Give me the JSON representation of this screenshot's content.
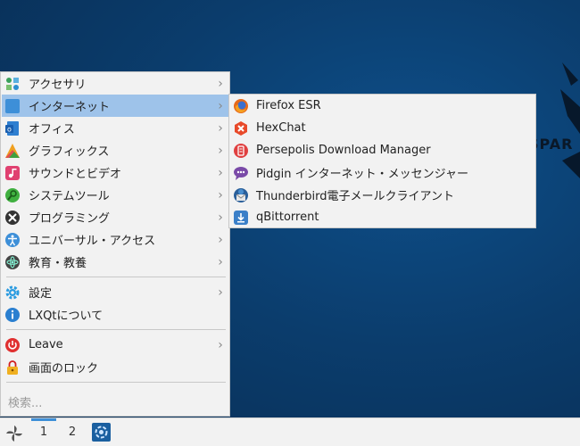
{
  "menu": {
    "items": [
      {
        "label": "アクセサリ",
        "icon": "accessories-icon",
        "has_submenu": true
      },
      {
        "label": "インターネット",
        "icon": "internet-icon",
        "has_submenu": true,
        "active": true
      },
      {
        "label": "オフィス",
        "icon": "office-icon",
        "has_submenu": true
      },
      {
        "label": "グラフィックス",
        "icon": "graphics-icon",
        "has_submenu": true
      },
      {
        "label": "サウンドとビデオ",
        "icon": "sound-video-icon",
        "has_submenu": true
      },
      {
        "label": "システムツール",
        "icon": "system-tools-icon",
        "has_submenu": true
      },
      {
        "label": "プログラミング",
        "icon": "programming-icon",
        "has_submenu": true
      },
      {
        "label": "ユニバーサル・アクセス",
        "icon": "accessibility-icon",
        "has_submenu": true
      },
      {
        "label": "教育・教養",
        "icon": "education-icon",
        "has_submenu": true
      }
    ],
    "settings_label": "設定",
    "about_label": "LXQtについて",
    "leave_label": "Leave",
    "lock_label": "画面のロック",
    "chevron": "›",
    "search_placeholder": "検索..."
  },
  "submenu": {
    "items": [
      {
        "label": "Firefox ESR",
        "icon": "firefox-icon"
      },
      {
        "label": "HexChat",
        "icon": "hexchat-icon"
      },
      {
        "label": "Persepolis Download Manager",
        "icon": "persepolis-icon"
      },
      {
        "label": "Pidgin インターネット・メッセンジャー",
        "icon": "pidgin-icon"
      },
      {
        "label": "Thunderbird電子メールクライアント",
        "icon": "thunderbird-icon"
      },
      {
        "label": "qBittorrent",
        "icon": "qbittorrent-icon"
      }
    ]
  },
  "taskbar": {
    "desktops": [
      "1",
      "2"
    ],
    "active_desktop": "1"
  },
  "colors": {
    "menu_bg": "#f2f2f2",
    "highlight": "#9ec3ea",
    "desktop_bg": "#0b3d6d",
    "active_desktop_indicator": "#3d8fd8"
  }
}
